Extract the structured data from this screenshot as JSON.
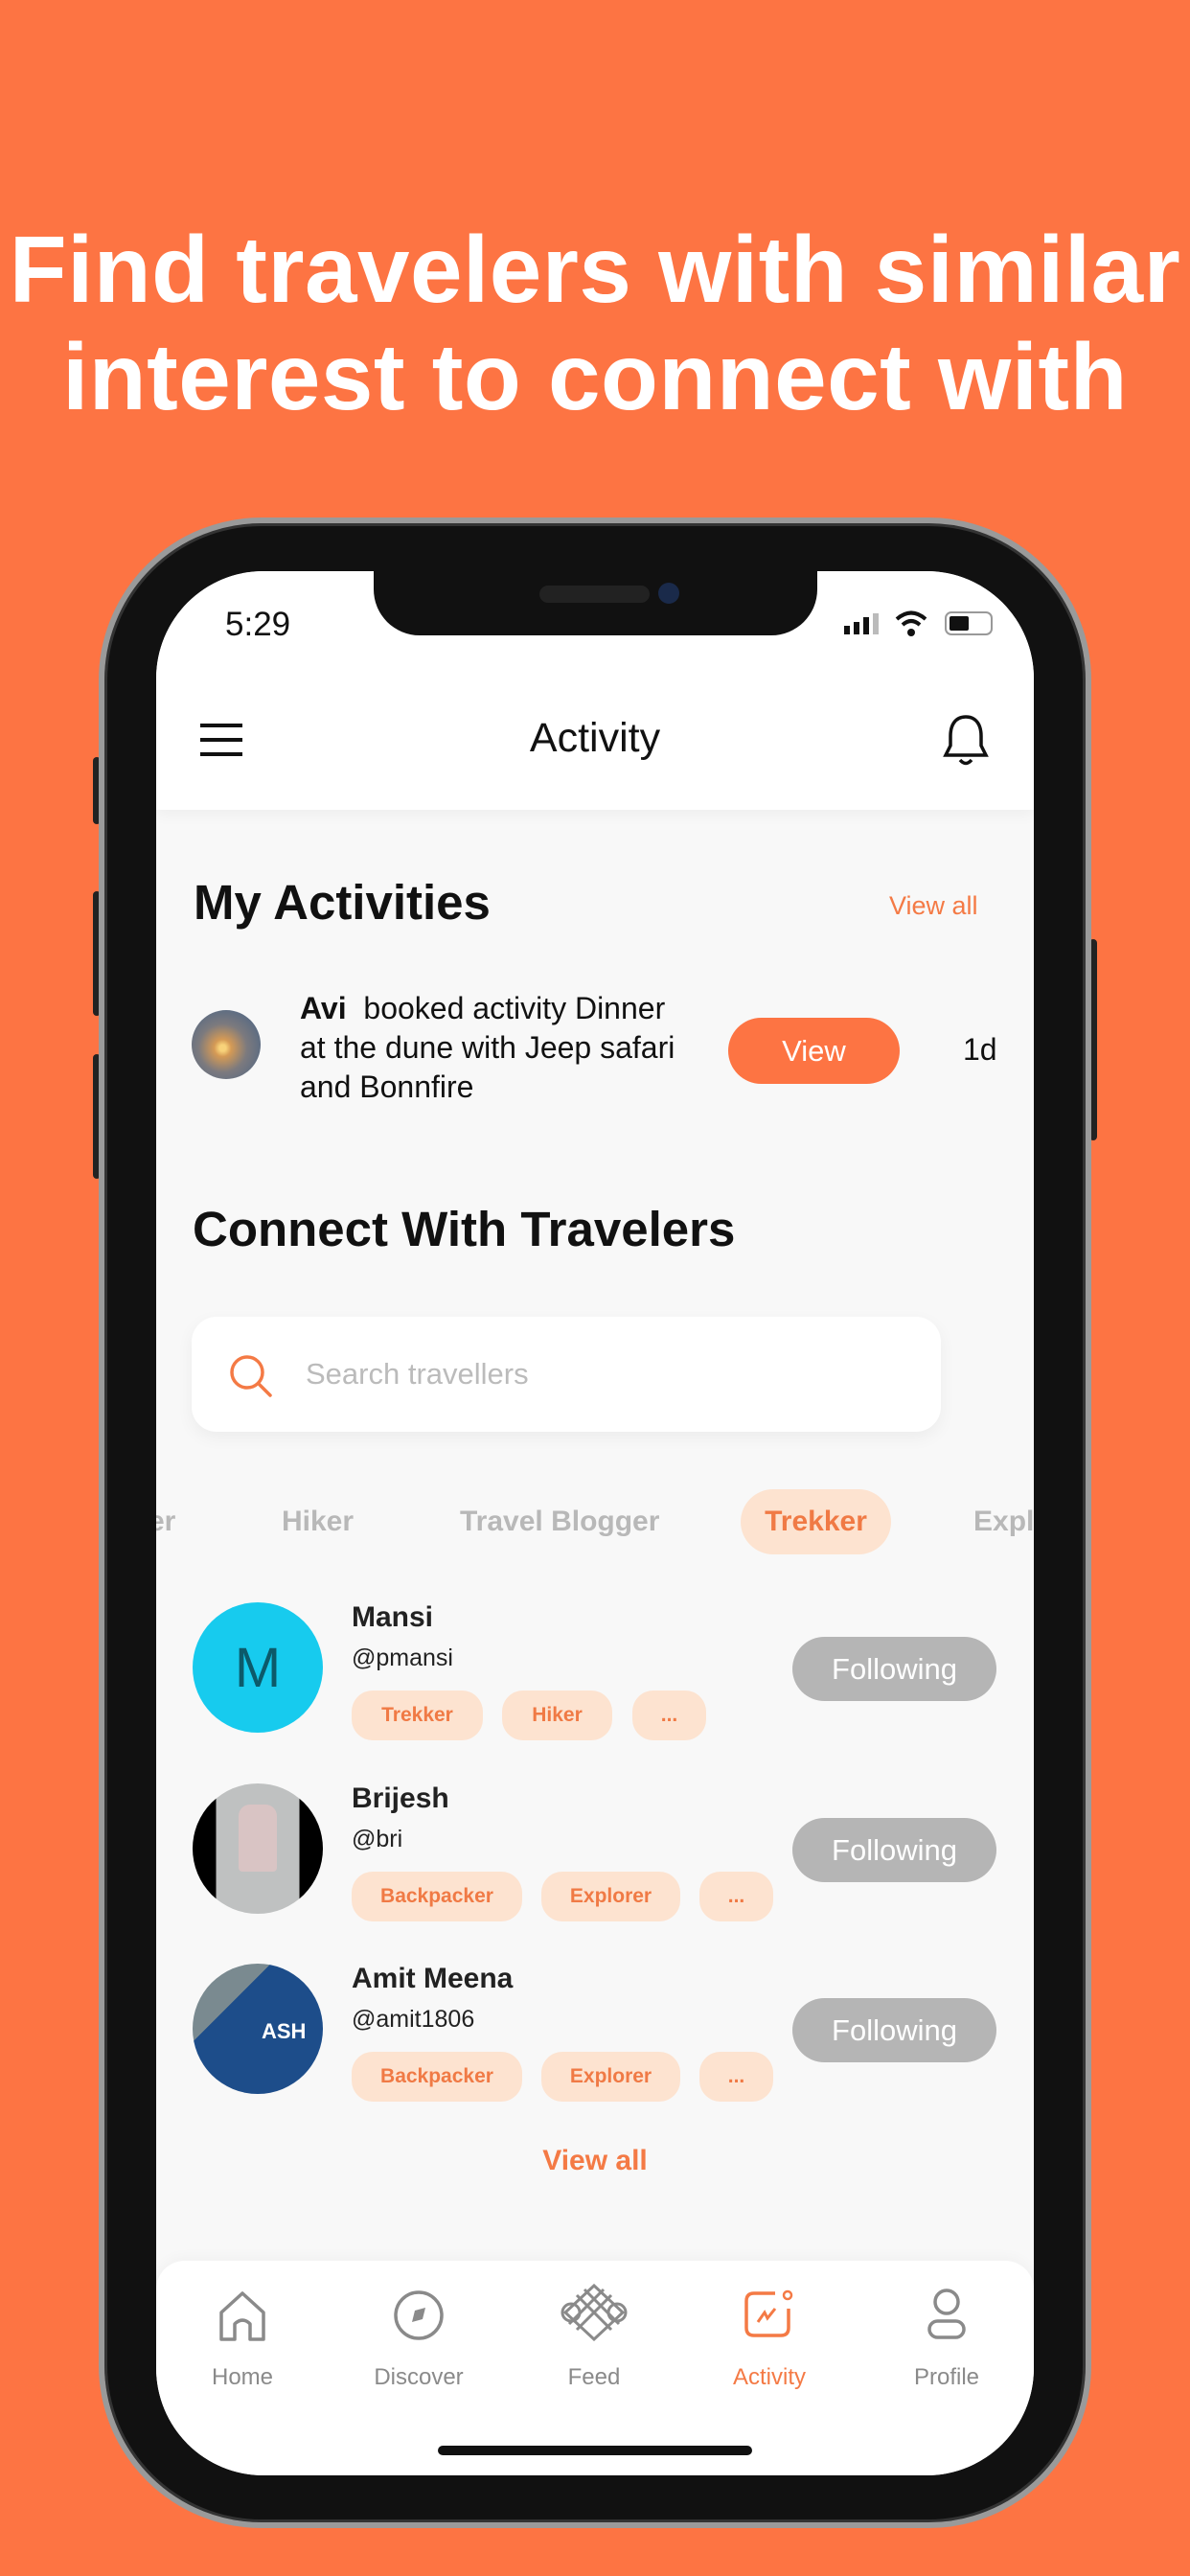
{
  "headline": [
    "Find travelers with similar",
    "interest to connect with"
  ],
  "status_bar": {
    "time": "5:29"
  },
  "header": {
    "title": "Activity",
    "menu_icon": "hamburger-icon",
    "notification_icon": "bell-icon"
  },
  "my_activities": {
    "title": "My Activities",
    "view_all": "View all",
    "items": [
      {
        "user": "Avi",
        "text_lines": [
          "booked activity Dinner",
          "at the dune with Jeep safari",
          "and Bonnfire"
        ],
        "button": "View",
        "time": "1d"
      }
    ]
  },
  "connect": {
    "title": "Connect With Travelers",
    "search_placeholder": "Search travellers",
    "filters": [
      {
        "label": "er",
        "active": false
      },
      {
        "label": "Hiker",
        "active": false
      },
      {
        "label": "Travel Blogger",
        "active": false
      },
      {
        "label": "Trekker",
        "active": true
      },
      {
        "label": "Expl",
        "active": false
      }
    ],
    "users": [
      {
        "name": "Mansi",
        "handle": "@pmansi",
        "initial": "M",
        "tags": [
          "Trekker",
          "Hiker",
          "..."
        ],
        "button": "Following"
      },
      {
        "name": "Brijesh",
        "handle": "@bri",
        "tags": [
          "Backpacker",
          "Explorer",
          "..."
        ],
        "button": "Following"
      },
      {
        "name": "Amit Meena",
        "handle": "@amit1806",
        "tags": [
          "Backpacker",
          "Explorer",
          "..."
        ],
        "button": "Following"
      }
    ],
    "view_all": "View all"
  },
  "bottom_nav": [
    {
      "label": "Home",
      "icon": "home-icon",
      "active": false
    },
    {
      "label": "Discover",
      "icon": "compass-icon",
      "active": false
    },
    {
      "label": "Feed",
      "icon": "knot-icon",
      "active": false
    },
    {
      "label": "Activity",
      "icon": "activity-chart-icon",
      "active": true
    },
    {
      "label": "Profile",
      "icon": "user-icon",
      "active": false
    }
  ],
  "colors": {
    "background": "#fd7443",
    "accent": "#f47a45",
    "tag_bg": "#fde3d0",
    "following": "#b5b5b5",
    "avatar_mansi": "#17cbee"
  }
}
